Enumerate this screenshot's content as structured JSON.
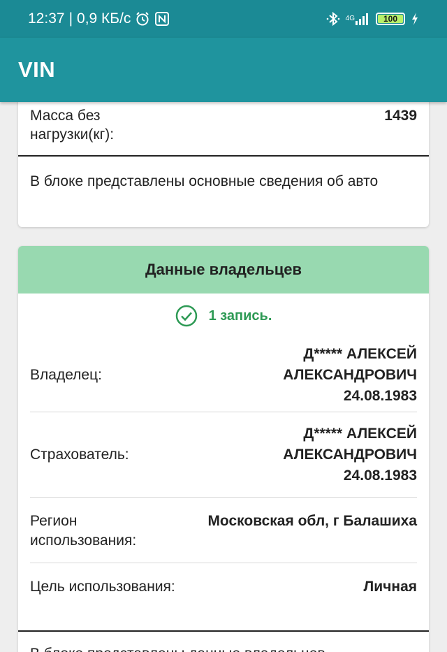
{
  "status_bar": {
    "time": "12:37",
    "separator": "|",
    "speed": "0,9 КБ/с",
    "net_type": "4G",
    "battery": "100"
  },
  "app_bar": {
    "title": "VIN"
  },
  "basic_info": {
    "mass_label": "Масса без нагрузки(кг):",
    "mass_value": "1439",
    "note": "В блоке представлены основные сведения об авто"
  },
  "owners": {
    "header": "Данные владельцев",
    "records": "1 запись.",
    "owner_label": "Владелец:",
    "owner_name_1": "Д***** АЛЕКСЕЙ",
    "owner_name_2": "АЛЕКСАНДРОВИЧ",
    "owner_date": "24.08.1983",
    "insurer_label": "Страхователь:",
    "insurer_name_1": "Д***** АЛЕКСЕЙ",
    "insurer_name_2": "АЛЕКСАНДРОВИЧ",
    "insurer_date": "24.08.1983",
    "region_label": "Регион использования:",
    "region_value": "Московская обл, г Балашиха",
    "purpose_label": "Цель использования:",
    "purpose_value": "Личная",
    "note": "В блоке представлены данные владельцев"
  },
  "icons": {
    "alarm": "alarm-icon",
    "nfc": "nfc-icon",
    "bluetooth": "bluetooth-icon",
    "signal": "signal-icon",
    "battery": "battery-icon",
    "charging": "charging-icon",
    "check": "check-circle-icon"
  },
  "colors": {
    "status_bar": "#1b8a95",
    "app_bar": "#1f949e",
    "card_header": "#98d9b0",
    "success": "#2e9a55"
  }
}
